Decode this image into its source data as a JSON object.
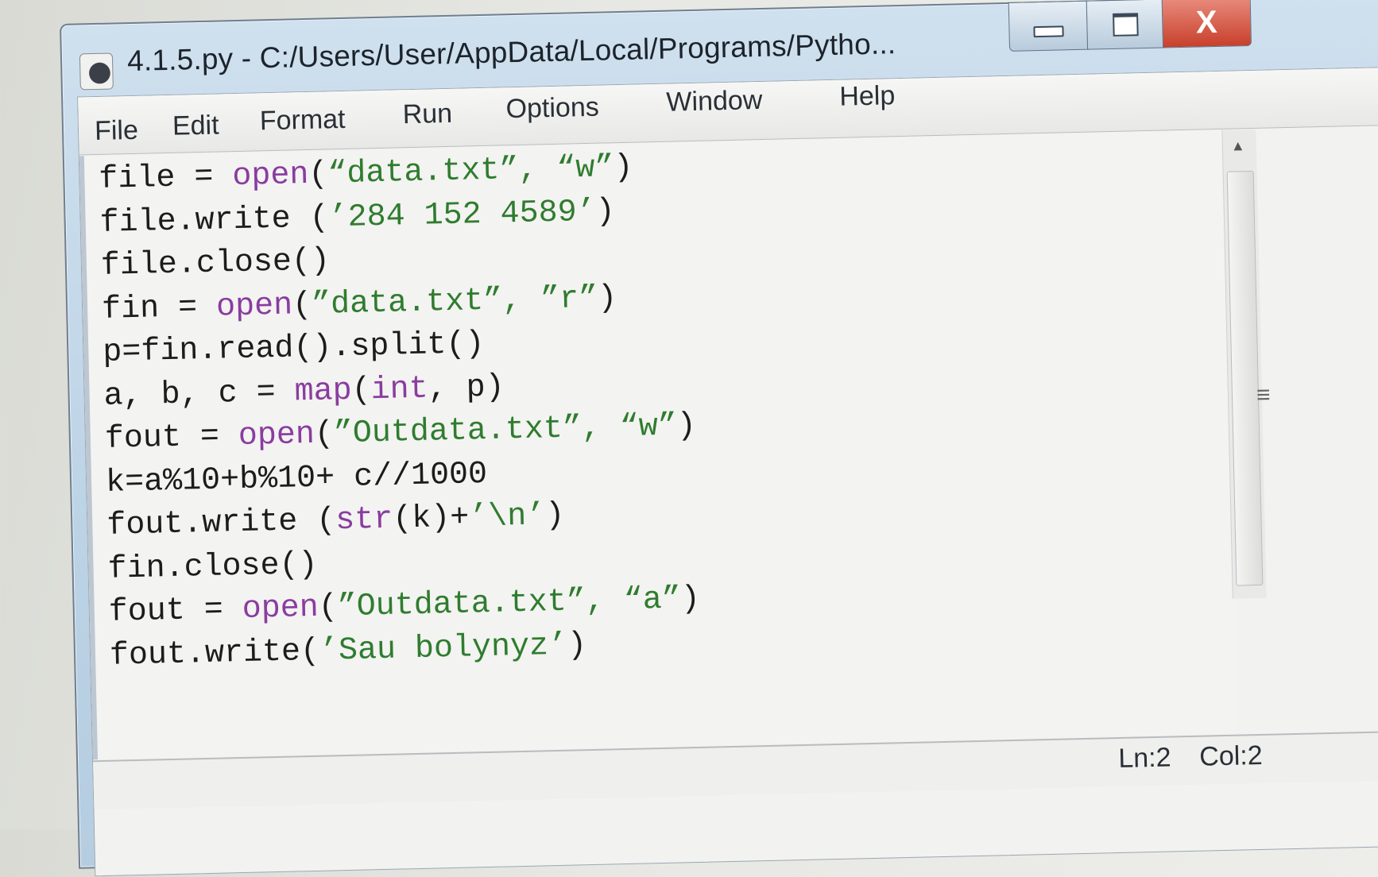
{
  "window": {
    "title": "4.1.5.py - C:/Users/User/AppData/Local/Programs/Pytho...",
    "controls": {
      "close_label": "X"
    }
  },
  "menu": [
    "File",
    "Edit",
    "Format",
    "Run",
    "Options",
    "Window",
    "Help"
  ],
  "editor": {
    "lines": [
      [
        {
          "t": "file = "
        },
        {
          "t": "open",
          "c": "kw"
        },
        {
          "t": "("
        },
        {
          "t": "“data.txt”, “w”",
          "c": "str"
        },
        {
          "t": ")"
        }
      ],
      [
        {
          "t": "file.write ("
        },
        {
          "t": "’284 152 4589’",
          "c": "str"
        },
        {
          "t": ")"
        }
      ],
      [
        {
          "t": "file.close()"
        }
      ],
      [
        {
          "t": "fin = "
        },
        {
          "t": "open",
          "c": "kw"
        },
        {
          "t": "("
        },
        {
          "t": "”data.txt”, ”r”",
          "c": "str"
        },
        {
          "t": ")"
        }
      ],
      [
        {
          "t": "p=fin.read().split()"
        }
      ],
      [
        {
          "t": "a, b, c = "
        },
        {
          "t": "map",
          "c": "kw"
        },
        {
          "t": "("
        },
        {
          "t": "int",
          "c": "kw"
        },
        {
          "t": ", p)"
        }
      ],
      [
        {
          "t": "fout = "
        },
        {
          "t": "open",
          "c": "kw"
        },
        {
          "t": "("
        },
        {
          "t": "”Outdata.txt”, “w”",
          "c": "str"
        },
        {
          "t": ")"
        }
      ],
      [
        {
          "t": "k=a%10+b%10+ c//1000"
        }
      ],
      [
        {
          "t": "fout.write ("
        },
        {
          "t": "str",
          "c": "kw"
        },
        {
          "t": "(k)+"
        },
        {
          "t": "’\\n’",
          "c": "str"
        },
        {
          "t": ")"
        }
      ],
      [
        {
          "t": "fin.close()"
        }
      ],
      [
        {
          "t": "fout = "
        },
        {
          "t": "open",
          "c": "kw"
        },
        {
          "t": "("
        },
        {
          "t": "”Outdata.txt”, “a”",
          "c": "str"
        },
        {
          "t": ")"
        }
      ],
      [
        {
          "t": "fout.write("
        },
        {
          "t": "’Sau bolynyz’",
          "c": "str"
        },
        {
          "t": ")"
        }
      ]
    ]
  },
  "status": {
    "line": "Ln:2",
    "col": "Col:2"
  },
  "colors": {
    "keyword": "#8a3ca0",
    "string": "#2f7c2f",
    "close_button": "#c8402c"
  }
}
